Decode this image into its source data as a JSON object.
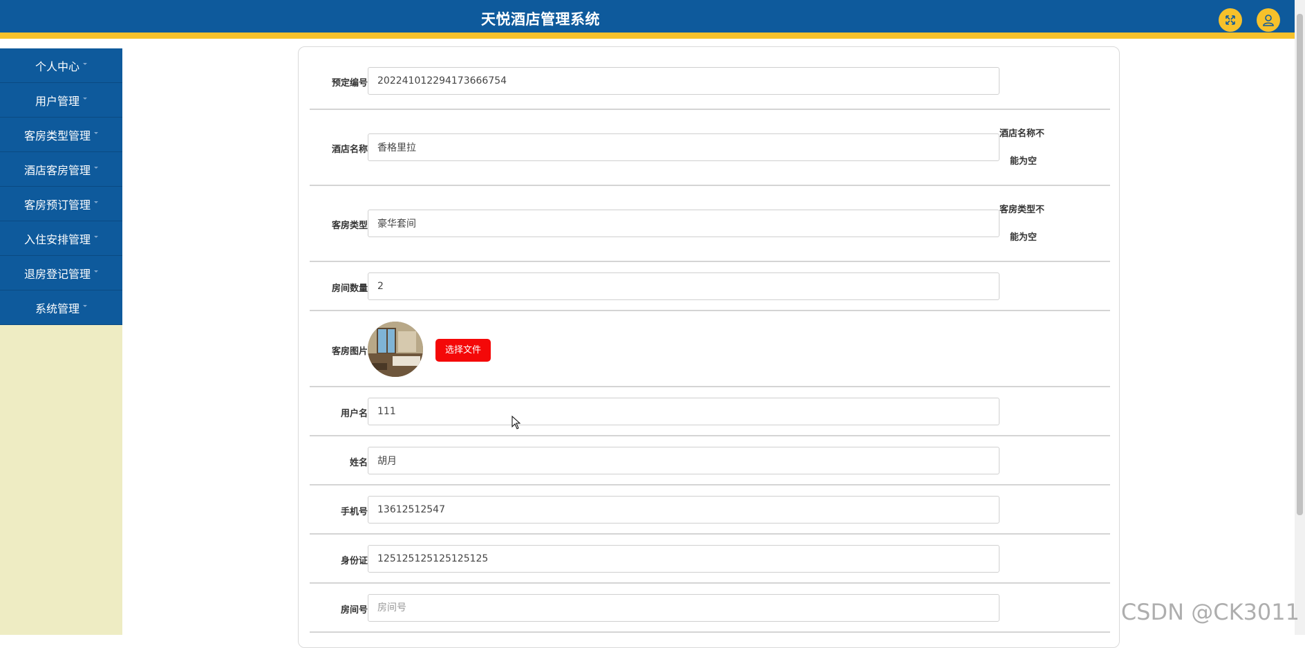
{
  "header": {
    "title": "天悦酒店管理系统",
    "accent": "#f6c12b",
    "bg": "#0e5a9c",
    "buttons": [
      {
        "icon": "fullscreen-icon"
      },
      {
        "icon": "user-icon"
      }
    ]
  },
  "sidebar": {
    "items": [
      {
        "label": "个人中心"
      },
      {
        "label": "用户管理"
      },
      {
        "label": "客房类型管理"
      },
      {
        "label": "酒店客房管理"
      },
      {
        "label": "客房预订管理"
      },
      {
        "label": "入住安排管理"
      },
      {
        "label": "退房登记管理"
      },
      {
        "label": "系统管理"
      }
    ]
  },
  "form": {
    "booking_no": {
      "label": "预定编号",
      "value": "202241012294173666754"
    },
    "hotel_name": {
      "label": "酒店名称",
      "value": "香格里拉",
      "error_line1": "酒店名称不",
      "error_line2": "能为空"
    },
    "room_type": {
      "label": "客房类型",
      "value": "豪华套间",
      "error_line1": "客房类型不",
      "error_line2": "能为空"
    },
    "room_count": {
      "label": "房间数量",
      "value": "2"
    },
    "room_image": {
      "label": "客房图片",
      "upload_label": "选择文件"
    },
    "username": {
      "label": "用户名",
      "value": "111"
    },
    "name": {
      "label": "姓名",
      "value": "胡月"
    },
    "phone": {
      "label": "手机号",
      "value": "13612512547"
    },
    "id_card": {
      "label": "身份证",
      "value": "125125125125125125"
    },
    "room_no": {
      "label": "房间号",
      "value": "",
      "placeholder": "房间号"
    }
  },
  "watermark": "CSDN @CK3011"
}
